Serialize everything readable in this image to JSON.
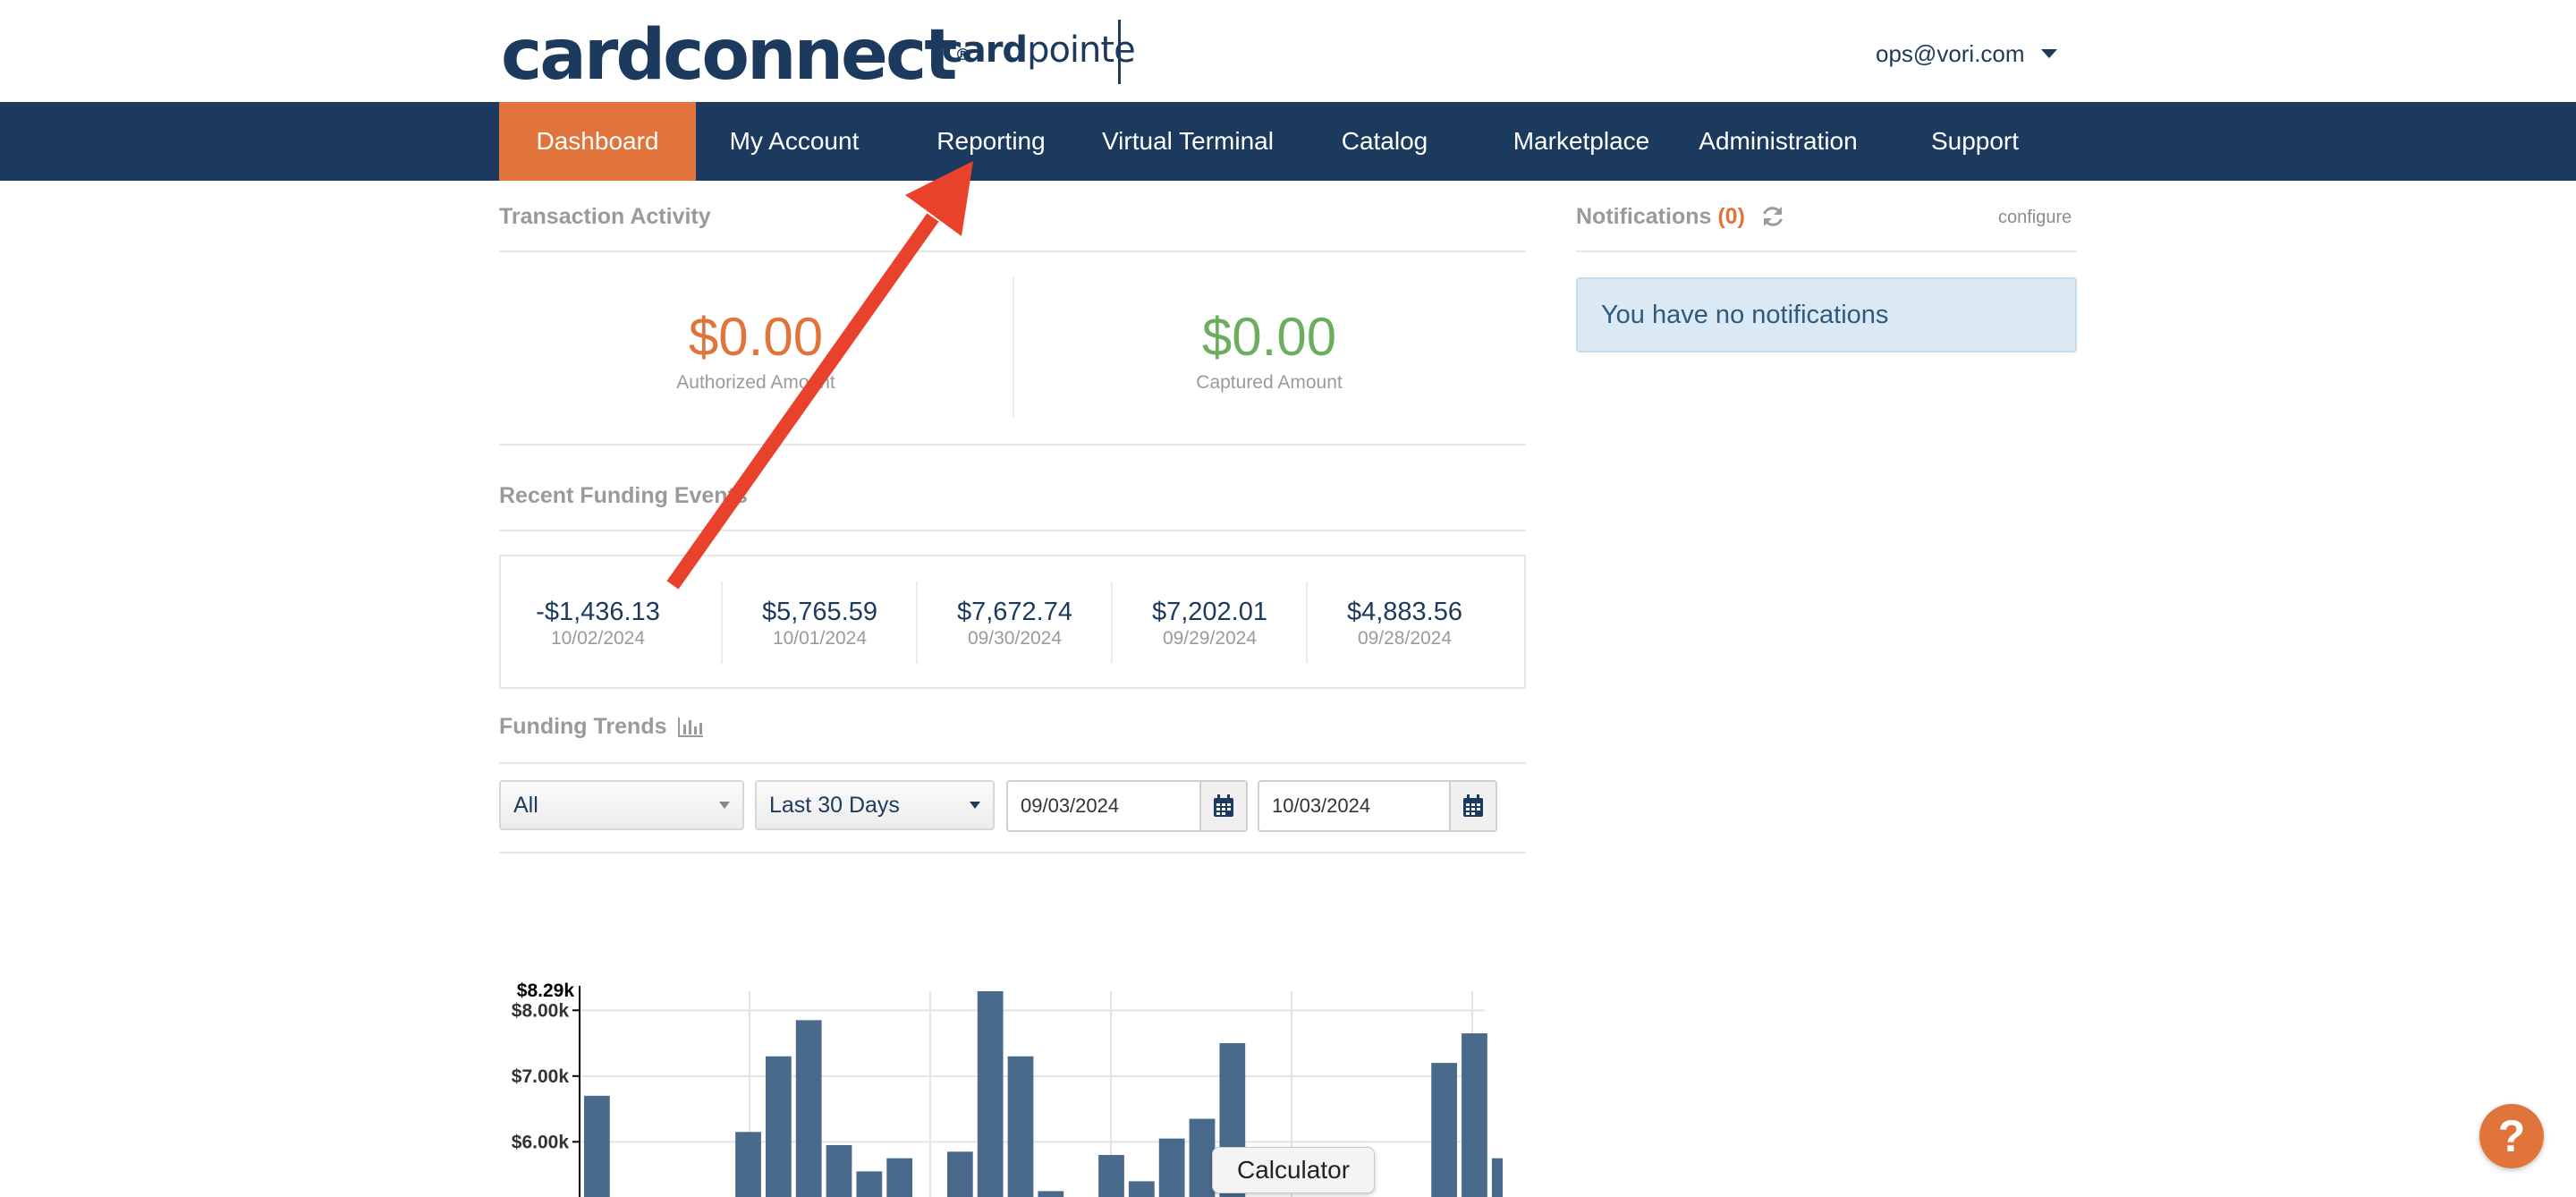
{
  "header": {
    "logo_main": "cardconnect",
    "logo_reg": "®",
    "logo_sub_bold": "card",
    "logo_sub_rest": "pointe",
    "user_email": "ops@vori.com"
  },
  "nav": {
    "items": [
      {
        "label": "Dashboard",
        "active": true
      },
      {
        "label": "My Account"
      },
      {
        "label": "Reporting"
      },
      {
        "label": "Virtual Terminal"
      },
      {
        "label": "Catalog"
      },
      {
        "label": "Marketplace"
      },
      {
        "label": "Administration"
      },
      {
        "label": "Support"
      }
    ]
  },
  "transaction_activity": {
    "title": "Transaction Activity",
    "authorized": {
      "amount": "$0.00",
      "label": "Authorized Amount",
      "color": "#e0743a"
    },
    "captured": {
      "amount": "$0.00",
      "label": "Captured Amount",
      "color": "#6cae5e"
    }
  },
  "recent_funding": {
    "title": "Recent Funding Events",
    "events": [
      {
        "amount": "-$1,436.13",
        "date": "10/02/2024"
      },
      {
        "amount": "$5,765.59",
        "date": "10/01/2024"
      },
      {
        "amount": "$7,672.74",
        "date": "09/30/2024"
      },
      {
        "amount": "$7,202.01",
        "date": "09/29/2024"
      },
      {
        "amount": "$4,883.56",
        "date": "09/28/2024"
      }
    ]
  },
  "funding_trends": {
    "title": "Funding Trends",
    "filter_type": "All",
    "filter_range": "Last 30 Days",
    "start_date": "09/03/2024",
    "end_date": "10/03/2024"
  },
  "notifications": {
    "title": "Notifications",
    "count": "(0)",
    "configure_label": "configure",
    "empty_message": "You have no notifications"
  },
  "tooltip": {
    "label": "Calculator"
  },
  "help": {
    "label": "?"
  },
  "colors": {
    "brand_navy": "#1c3a5e",
    "accent_orange": "#e0743a",
    "bar_fill": "#4a6a8c",
    "annotation_red": "#e8412c"
  },
  "chart_data": {
    "type": "bar",
    "title": "",
    "ymax_label": "$8.29k",
    "ytick_labels": [
      "$8.00k",
      "$7.00k",
      "$6.00k"
    ],
    "ytick_values": [
      8000,
      7000,
      6000
    ],
    "ylim": [
      5000,
      8290
    ],
    "grid": true,
    "values": [
      6700,
      null,
      null,
      null,
      null,
      6150,
      7300,
      7850,
      5950,
      5550,
      5750,
      null,
      5850,
      8290,
      7300,
      5250,
      null,
      5800,
      5400,
      6050,
      6350,
      7500,
      5000,
      5000,
      null,
      null,
      null,
      null,
      7200,
      7650,
      5750
    ]
  }
}
